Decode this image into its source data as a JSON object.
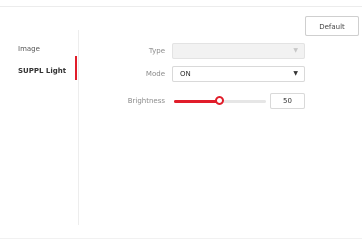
{
  "toolbar": {
    "default_label": "Default"
  },
  "sidebar": {
    "items": [
      {
        "label": "Image",
        "active": false
      },
      {
        "label": "SUPPL Light",
        "active": true
      }
    ]
  },
  "form": {
    "type": {
      "label": "Type",
      "value": "",
      "disabled": true
    },
    "mode": {
      "label": "Mode",
      "value": "ON"
    },
    "brightness": {
      "label": "Brightness",
      "value": "50",
      "level_percent": 50
    }
  },
  "colors": {
    "accent": "#e11d2a"
  },
  "icons": {
    "dropdown": "chevron-down-icon"
  }
}
